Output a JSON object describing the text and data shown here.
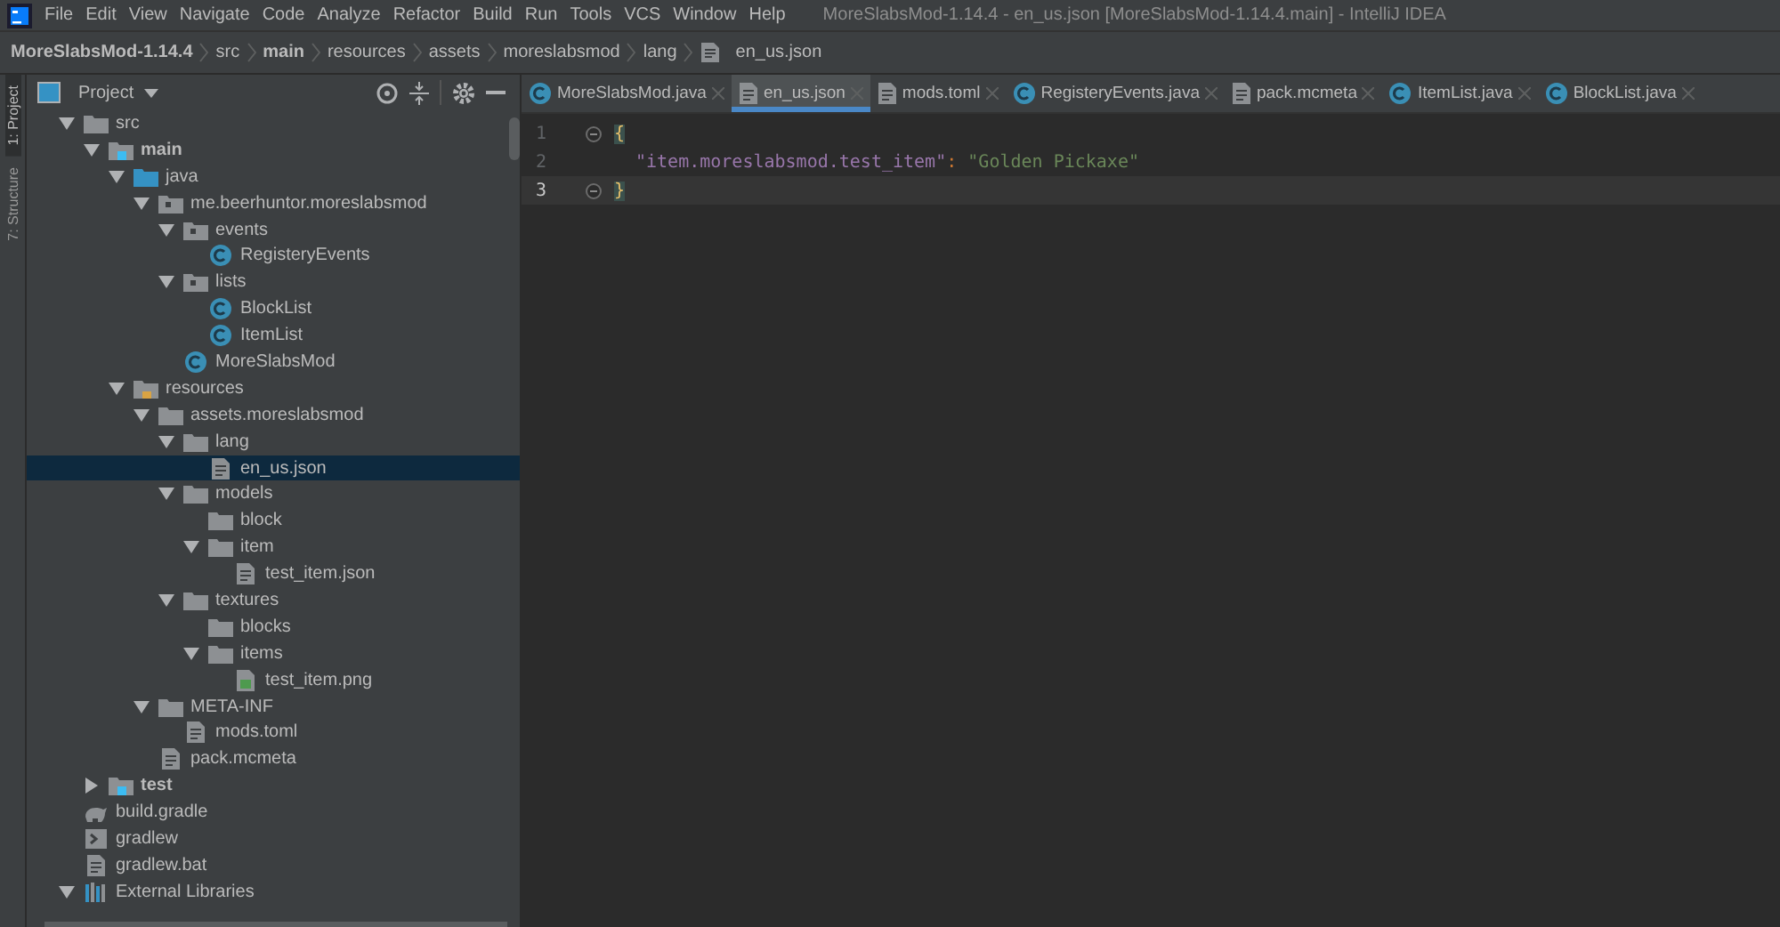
{
  "window": {
    "title": "MoreSlabsMod-1.14.4 - en_us.json [MoreSlabsMod-1.14.4.main] - IntelliJ IDEA"
  },
  "menu": [
    "File",
    "Edit",
    "View",
    "Navigate",
    "Code",
    "Analyze",
    "Refactor",
    "Build",
    "Run",
    "Tools",
    "VCS",
    "Window",
    "Help"
  ],
  "breadcrumb": [
    {
      "label": "MoreSlabsMod-1.14.4",
      "bold": true
    },
    {
      "label": "src",
      "bold": false
    },
    {
      "label": "main",
      "bold": true
    },
    {
      "label": "resources",
      "bold": false
    },
    {
      "label": "assets",
      "bold": false
    },
    {
      "label": "moreslabsmod",
      "bold": false
    },
    {
      "label": "lang",
      "bold": false
    },
    {
      "label": "en_us.json",
      "bold": false,
      "kind": "json"
    }
  ],
  "tool_strip": [
    {
      "label": "1: Project",
      "selected": true
    },
    {
      "label": "7: Structure",
      "selected": false
    }
  ],
  "project_panel": {
    "title": "Project",
    "tree": [
      {
        "label": "src",
        "kind": "folder",
        "expanded": true,
        "children": [
          {
            "label": "main",
            "kind": "module",
            "bold": true,
            "expanded": true,
            "children": [
              {
                "label": "java",
                "kind": "source",
                "expanded": true,
                "children": [
                  {
                    "label": "me.beerhuntor.moreslabsmod",
                    "kind": "package",
                    "expanded": true,
                    "children": [
                      {
                        "label": "events",
                        "kind": "package",
                        "expanded": true,
                        "children": [
                          {
                            "label": "RegisteryEvents",
                            "kind": "class"
                          }
                        ]
                      },
                      {
                        "label": "lists",
                        "kind": "package",
                        "expanded": true,
                        "children": [
                          {
                            "label": "BlockList",
                            "kind": "class"
                          },
                          {
                            "label": "ItemList",
                            "kind": "class"
                          }
                        ]
                      },
                      {
                        "label": "MoreSlabsMod",
                        "kind": "class"
                      }
                    ]
                  }
                ]
              },
              {
                "label": "resources",
                "kind": "resources",
                "expanded": true,
                "children": [
                  {
                    "label": "assets.moreslabsmod",
                    "kind": "folder",
                    "expanded": true,
                    "children": [
                      {
                        "label": "lang",
                        "kind": "folder",
                        "expanded": true,
                        "children": [
                          {
                            "label": "en_us.json",
                            "kind": "json",
                            "selected": true
                          }
                        ]
                      },
                      {
                        "label": "models",
                        "kind": "folder",
                        "expanded": true,
                        "children": [
                          {
                            "label": "block",
                            "kind": "folder"
                          },
                          {
                            "label": "item",
                            "kind": "folder",
                            "expanded": true,
                            "children": [
                              {
                                "label": "test_item.json",
                                "kind": "json",
                                "selected": false
                              }
                            ]
                          }
                        ]
                      },
                      {
                        "label": "textures",
                        "kind": "folder",
                        "expanded": true,
                        "children": [
                          {
                            "label": "blocks",
                            "kind": "folder"
                          },
                          {
                            "label": "items",
                            "kind": "folder",
                            "expanded": true,
                            "children": [
                              {
                                "label": "test_item.png",
                                "kind": "image"
                              }
                            ]
                          }
                        ]
                      }
                    ]
                  },
                  {
                    "label": "META-INF",
                    "kind": "folder",
                    "expanded": true,
                    "children": [
                      {
                        "label": "mods.toml",
                        "kind": "toml"
                      }
                    ]
                  },
                  {
                    "label": "pack.mcmeta",
                    "kind": "file"
                  }
                ]
              }
            ]
          },
          {
            "label": "test",
            "kind": "module",
            "bold": true,
            "expanded": false
          }
        ]
      },
      {
        "label": "build.gradle",
        "kind": "gradle"
      },
      {
        "label": "gradlew",
        "kind": "script"
      },
      {
        "label": "gradlew.bat",
        "kind": "file"
      },
      {
        "label": "External Libraries",
        "kind": "library",
        "expanded": true
      }
    ]
  },
  "tabs": [
    {
      "label": "MoreSlabsMod.java",
      "kind": "class",
      "selected": false
    },
    {
      "label": "en_us.json",
      "kind": "json",
      "selected": true
    },
    {
      "label": "mods.toml",
      "kind": "toml",
      "selected": false
    },
    {
      "label": "RegisteryEvents.java",
      "kind": "class",
      "selected": false
    },
    {
      "label": "pack.mcmeta",
      "kind": "file",
      "selected": false
    },
    {
      "label": "ItemList.java",
      "kind": "class",
      "selected": false
    },
    {
      "label": "BlockList.java",
      "kind": "class",
      "selected": false
    }
  ],
  "editor": {
    "lines": [
      {
        "number": "1",
        "current": false,
        "tokens": [
          {
            "text": "{",
            "kind": "brace"
          }
        ]
      },
      {
        "number": "2",
        "current": false,
        "indented": true,
        "tokens": [
          {
            "text": "\"item.moreslabsmod.test_item\"",
            "kind": "key"
          },
          {
            "text": ": ",
            "kind": "punct"
          },
          {
            "text": "\"Golden Pickaxe\"",
            "kind": "string"
          }
        ]
      },
      {
        "number": "3",
        "current": true,
        "tokens": [
          {
            "text": "}",
            "kind": "brace"
          }
        ]
      }
    ]
  }
}
